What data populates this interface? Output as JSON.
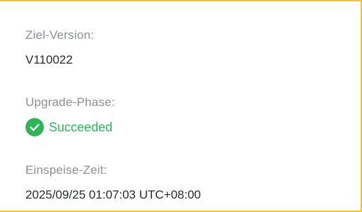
{
  "fields": {
    "target_version": {
      "label": "Ziel-Version:",
      "value": "V110022"
    },
    "upgrade_phase": {
      "label": "Upgrade-Phase:",
      "status": "Succeeded",
      "status_icon": "check-circle-icon",
      "status_color": "#2fb559"
    },
    "feed_time": {
      "label": "Einspeise-Zeit:",
      "value": "2025/09/25 01:07:03 UTC+08:00"
    }
  },
  "colors": {
    "border_accent": "#f4c430",
    "label": "#8a8f99",
    "value": "#262a33",
    "success": "#2fb559"
  }
}
